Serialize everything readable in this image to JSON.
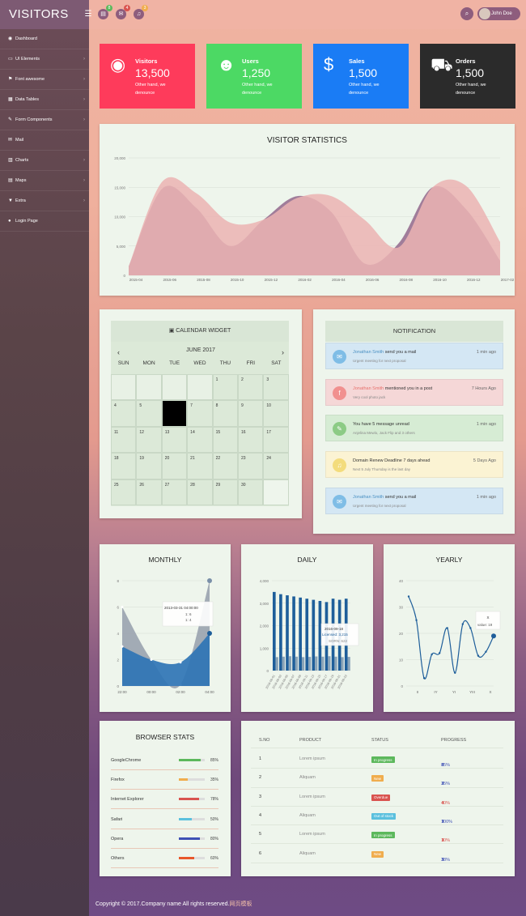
{
  "brand": "VISITORS",
  "header": {
    "badges": [
      "8",
      "4",
      "3"
    ],
    "user_name": "John Doe"
  },
  "sidebar": {
    "items": [
      {
        "label": "Dashboard",
        "icon": "dashboard-icon",
        "arrow": false
      },
      {
        "label": "UI Elements",
        "icon": "desktop-icon",
        "arrow": true
      },
      {
        "label": "Font awesome",
        "icon": "flag-icon",
        "arrow": true
      },
      {
        "label": "Data Tables",
        "icon": "table-icon",
        "arrow": true
      },
      {
        "label": "Form Components",
        "icon": "edit-icon",
        "arrow": true
      },
      {
        "label": "Mail",
        "icon": "envelope-icon",
        "arrow": false
      },
      {
        "label": "Charts",
        "icon": "bar-chart-icon",
        "arrow": true
      },
      {
        "label": "Maps",
        "icon": "map-icon",
        "arrow": true
      },
      {
        "label": "Extra",
        "icon": "glass-icon",
        "arrow": true
      },
      {
        "label": "Login Page",
        "icon": "user-icon",
        "arrow": false
      }
    ]
  },
  "stats": [
    {
      "label": "Visitors",
      "value": "13,500",
      "sub": "Other hand, we denounce",
      "color": "#fe3b5b",
      "icon": "eye-icon"
    },
    {
      "label": "Users",
      "value": "1,250",
      "sub": "Other hand, we denounce",
      "color": "#4cd964",
      "icon": "users-icon"
    },
    {
      "label": "Sales",
      "value": "1,500",
      "sub": "Other hand, we denounce",
      "color": "#1a7cf5",
      "icon": "dollar-icon"
    },
    {
      "label": "Orders",
      "value": "1,500",
      "sub": "Other hand, we denounce",
      "color": "#2b2b2b",
      "icon": "cart-icon"
    }
  ],
  "visitor_chart": {
    "title": "VISITOR STATISTICS"
  },
  "calendar": {
    "title": "CALENDAR WIDGET",
    "month": "JUNE 2017",
    "days": [
      "SUN",
      "MON",
      "TUE",
      "WED",
      "THU",
      "FRI",
      "SAT"
    ],
    "cells": [
      "",
      "",
      "",
      "",
      "1",
      "2",
      "3",
      "4",
      "5",
      "6",
      "7",
      "8",
      "9",
      "10",
      "11",
      "12",
      "13",
      "14",
      "15",
      "16",
      "17",
      "18",
      "19",
      "20",
      "21",
      "22",
      "23",
      "24",
      "25",
      "26",
      "27",
      "28",
      "29",
      "30",
      ""
    ],
    "today": "6"
  },
  "notification": {
    "title": "NOTIFICATION",
    "items": [
      {
        "name": "Jonathan Smith",
        "text": " send you a mail",
        "sub": "Urgent meeting for next proposal",
        "time": "1 min ago",
        "bg": "#d4e7f4",
        "ic": "#7fbde6",
        "name_color": "#4a90c2",
        "icon": "envelope-icon"
      },
      {
        "name": "Jonathan Smith",
        "text": " mentioned you in a post",
        "sub": "Very cool photo jack",
        "time": "7 Hours Ago",
        "bg": "#f5d7d7",
        "ic": "#f1908f",
        "name_color": "#e7706c",
        "icon": "facebook-icon"
      },
      {
        "name": "",
        "text": "You have 5 message unread",
        "sub": "Anjelina Mewlo, Jack Flip and 3 others",
        "time": "1 min ago",
        "bg": "#d6ecd4",
        "ic": "#8ccb85",
        "name_color": "#333",
        "icon": "comments-icon"
      },
      {
        "name": "",
        "text": "Domain Renew Deadline 7 days ahead",
        "sub": "Next 5 July Thursday is the last day",
        "time": "5 Days Ago",
        "bg": "#fbf3d3",
        "ic": "#f3dc7c",
        "name_color": "#333",
        "icon": "bell-icon"
      },
      {
        "name": "Jonathan Smith",
        "text": " send you a mail",
        "sub": "Urgent meeting for next proposal",
        "time": "1 min ago",
        "bg": "#d4e7f4",
        "ic": "#7fbde6",
        "name_color": "#4a90c2",
        "icon": "envelope-icon"
      }
    ]
  },
  "chart_data": [
    {
      "type": "area",
      "title": "VISITOR STATISTICS",
      "categories": [
        "2015-04",
        "2015-06",
        "2015-08",
        "2015-10",
        "2015-12",
        "2016-02",
        "2016-04",
        "2016-06",
        "2016-08",
        "2016-10",
        "2016-12",
        "2017-02"
      ],
      "ylim": [
        0,
        20000
      ],
      "yticks": [
        "0",
        "5,000",
        "10,000",
        "15,000",
        "20,000"
      ],
      "series": [
        {
          "values": [
            1500,
            14800,
            11500,
            5000,
            9500,
            13500,
            10800,
            2000,
            5500,
            15000,
            11200,
            2500
          ],
          "color": "#a07d9a"
        },
        {
          "values": [
            1500,
            16000,
            14000,
            9000,
            9500,
            13200,
            13500,
            9400,
            4800,
            15000,
            15200,
            5700
          ],
          "color": "#ebb3b3"
        }
      ]
    },
    {
      "type": "area",
      "title": "MONTHLY",
      "categories": [
        "22:00",
        "00:00",
        "02:00",
        "04:00"
      ],
      "ylim": [
        0,
        8
      ],
      "yticks": [
        "0",
        "2",
        "4",
        "6",
        "8"
      ],
      "series": [
        {
          "values": [
            6,
            2,
            0.1,
            8
          ],
          "color": "#9ba4b0"
        },
        {
          "values": [
            3,
            2,
            1.8,
            4
          ],
          "color": "#2f74b5"
        }
      ],
      "tooltip": {
        "title": "2013-03-31 04:00:00",
        "lines": [
          "1: 6",
          "1: 4"
        ]
      }
    },
    {
      "type": "bar",
      "title": "DAILY",
      "ylim": [
        0,
        4000
      ],
      "yticks": [
        "0",
        "1,000",
        "2,000",
        "3,000",
        "4,000"
      ],
      "categories": [
        "2016-09-01",
        "2016-09-03",
        "2016-09-05",
        "2016-09-07",
        "2016-09-09",
        "2016-09-11",
        "2016-09-13",
        "2016-09-15",
        "2016-09-17",
        "2016-09-19",
        "2016-09-21",
        "2016-09-23"
      ],
      "series": [
        {
          "values": [
            3500,
            3400,
            3350,
            3300,
            3250,
            3200,
            3150,
            3100,
            3050,
            3200,
            3150,
            3200
          ],
          "color": "#1e5e9a"
        },
        {
          "values": [
            600,
            620,
            640,
            620,
            600,
            610,
            630,
            620,
            640,
            620,
            600,
            610
          ],
          "color": "#8aa4b8"
        }
      ],
      "tooltip": {
        "title": "2016-09-18",
        "lines": [
          "Licensed: 3,215",
          "SORN: 622"
        ]
      }
    },
    {
      "type": "line",
      "title": "YEARLY",
      "categories": [
        "II",
        "IY",
        "YI",
        "YIII",
        "X"
      ],
      "ylim": [
        0,
        40
      ],
      "yticks": [
        "0",
        "10",
        "20",
        "30",
        "40"
      ],
      "series": [
        {
          "values": [
            34,
            25,
            3,
            12,
            12.5,
            22,
            5,
            23.5,
            22,
            11.5,
            13,
            19
          ],
          "color": "#1e5e9a"
        }
      ],
      "tooltip": {
        "title": "X",
        "lines": [
          "value: 19"
        ]
      }
    }
  ],
  "browser": {
    "title": "BROWSER STATS",
    "items": [
      {
        "name": "GoogleChrome",
        "pct": 85,
        "label": "85%",
        "color": "#5cb85c"
      },
      {
        "name": "Firefox",
        "pct": 35,
        "label": "35%",
        "color": "#f0ad4e"
      },
      {
        "name": "Internet Explorer",
        "pct": 78,
        "label": "78%",
        "color": "#d9534f"
      },
      {
        "name": "Safari",
        "pct": 50,
        "label": "50%",
        "color": "#5bc0de"
      },
      {
        "name": "Opera",
        "pct": 80,
        "label": "80%",
        "color": "#3f51b5"
      },
      {
        "name": "Others",
        "pct": 60,
        "label": "60%",
        "color": "#e8572b"
      }
    ]
  },
  "table": {
    "headers": [
      "S.NO",
      "PRODUCT",
      "STATUS",
      "PROGRESS"
    ],
    "rows": [
      {
        "no": "1",
        "product": "Lorem ipsum",
        "status": "In progress",
        "status_color": "#5cb85c",
        "progress": "85%",
        "arrow": "⬆",
        "pcolor": "#3f51b5"
      },
      {
        "no": "2",
        "product": "Aliquam",
        "status": "New",
        "status_color": "#f0ad4e",
        "progress": "35%",
        "arrow": "⬇",
        "pcolor": "#3f51b5"
      },
      {
        "no": "3",
        "product": "Lorem ipsum",
        "status": "Overdue",
        "status_color": "#d9534f",
        "progress": "40%",
        "arrow": "⬇",
        "pcolor": "#d9534f"
      },
      {
        "no": "4",
        "product": "Aliquam",
        "status": "Out of stock",
        "status_color": "#5bc0de",
        "progress": "100%",
        "arrow": "⬆",
        "pcolor": "#3f51b5"
      },
      {
        "no": "5",
        "product": "Lorem ipsum",
        "status": "In progress",
        "status_color": "#5cb85c",
        "progress": "10%",
        "arrow": "⬇",
        "pcolor": "#d9534f"
      },
      {
        "no": "6",
        "product": "Aliquam",
        "status": "New",
        "status_color": "#f0ad4e",
        "progress": "38%",
        "arrow": "⬆",
        "pcolor": "#3f51b5"
      }
    ]
  },
  "footer": {
    "text": "Copyright © 2017.Company name All rights reserved.",
    "link": "网页模板"
  }
}
